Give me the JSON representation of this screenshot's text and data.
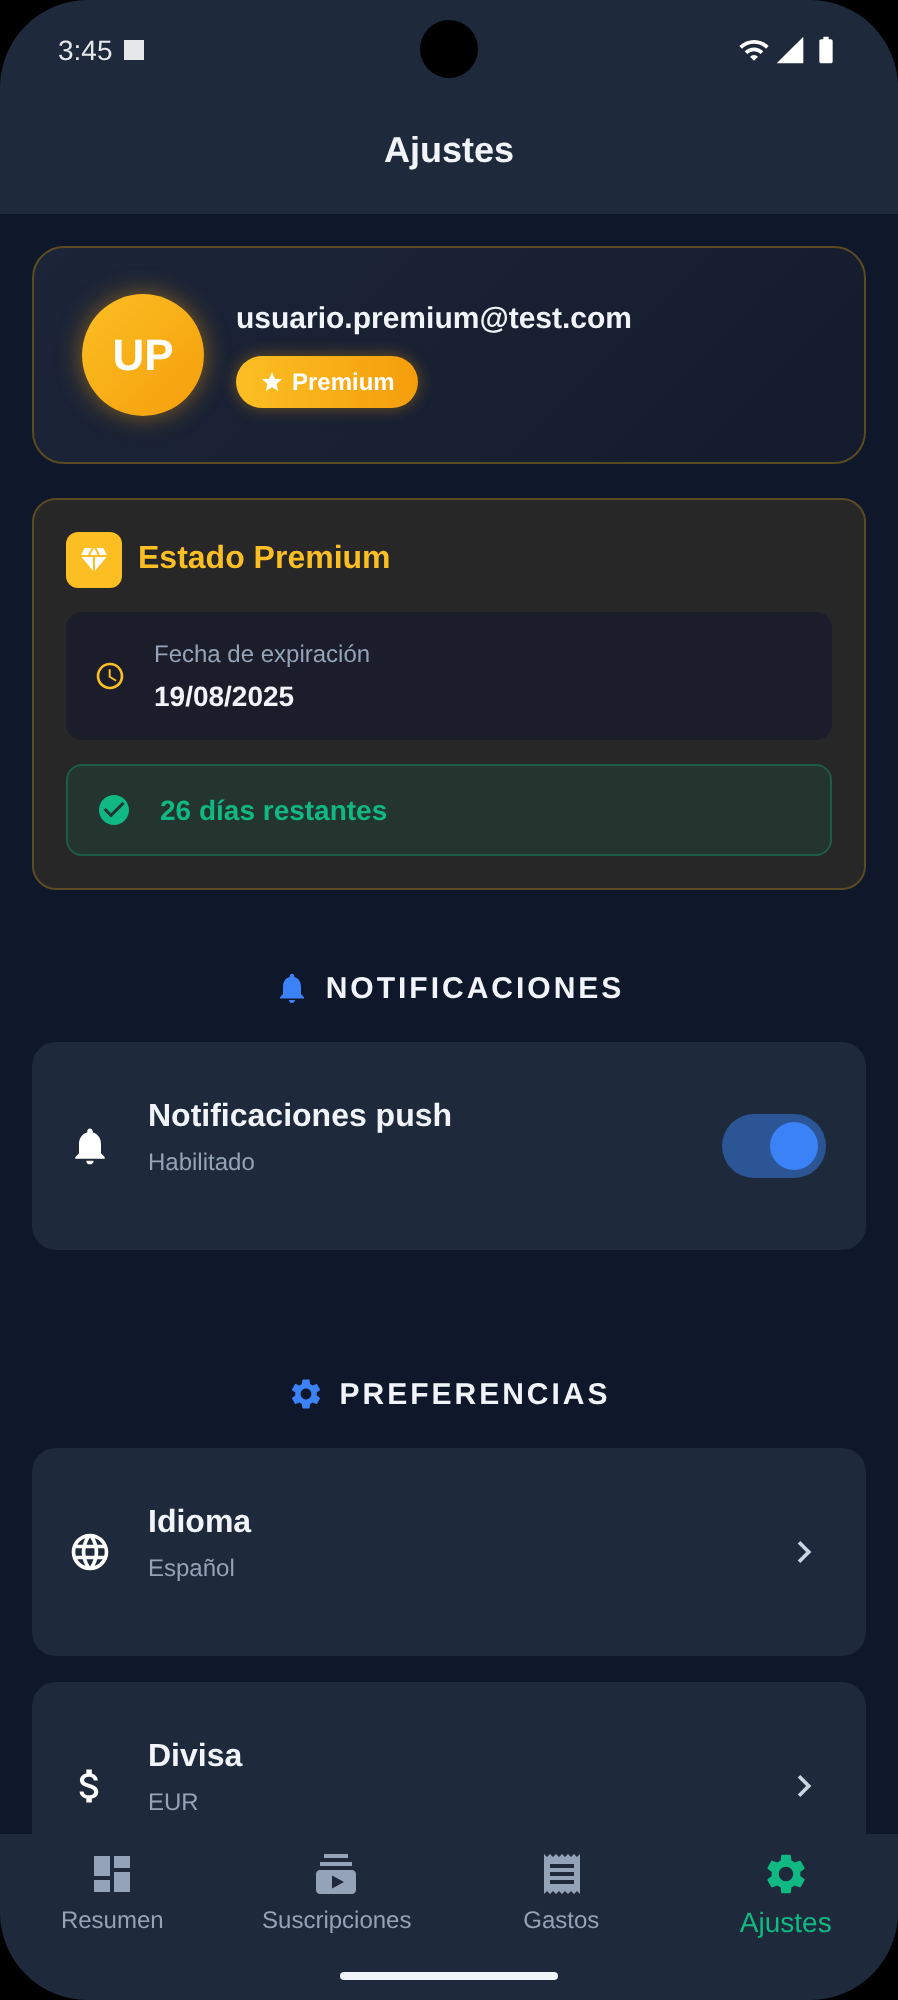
{
  "status_bar": {
    "time": "3:45"
  },
  "app_bar": {
    "title": "Ajustes"
  },
  "profile": {
    "initials": "UP",
    "email": "usuario.premium@test.com",
    "badge": "Premium"
  },
  "premium": {
    "title": "Estado Premium",
    "expiry_label": "Fecha de expiración",
    "expiry_date": "19/08/2025",
    "remaining": "26 días restantes"
  },
  "sections": [
    {
      "title": "NOTIFICACIONES",
      "items": [
        {
          "kind": "toggle",
          "title": "Notificaciones push",
          "subtitle": "Habilitado",
          "on": true
        }
      ]
    },
    {
      "title": "PREFERENCIAS",
      "items": [
        {
          "kind": "link",
          "title": "Idioma",
          "subtitle": "Español"
        },
        {
          "kind": "link",
          "title": "Divisa",
          "subtitle": "EUR"
        }
      ]
    }
  ],
  "bottom_nav": [
    {
      "label": "Resumen",
      "selected": false
    },
    {
      "label": "Suscripciones",
      "selected": false
    },
    {
      "label": "Gastos",
      "selected": false
    },
    {
      "label": "Ajustes",
      "selected": true
    }
  ]
}
